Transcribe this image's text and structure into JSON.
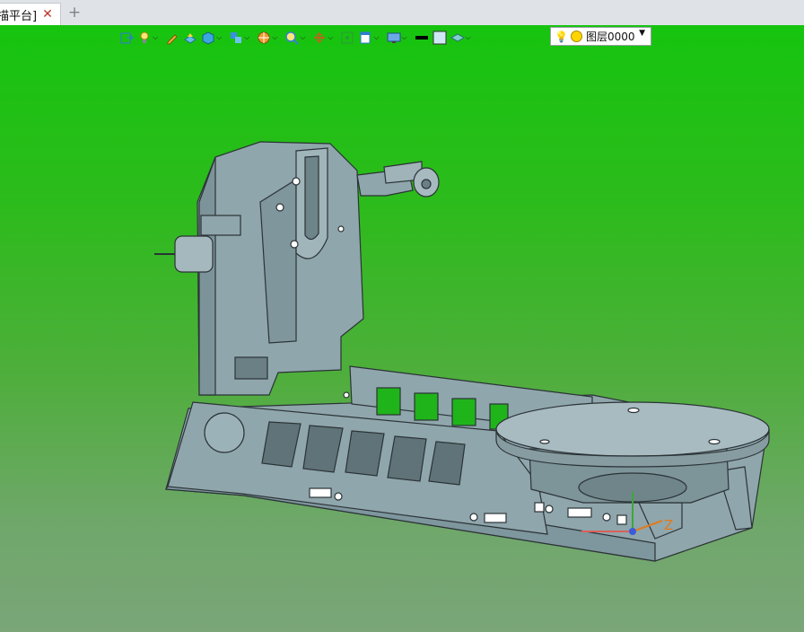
{
  "tabs": [
    {
      "label": "描平台]",
      "close_icon": "close-icon"
    }
  ],
  "add_tab_glyph": "+",
  "toolbar": {
    "icons": [
      "exit-sketch-icon",
      "light-bulb-icon",
      "pencil-icon",
      "extrude-icon",
      "solid-cube-icon",
      "assembly-cube-icon",
      "render-sphere-icon",
      "zoom-icon",
      "rotate-axis-icon",
      "fit-view-icon",
      "view-panel-icon",
      "display-monitor-icon",
      "line-color-swatch-icon",
      "fill-color-swatch-icon",
      "layer-stack-icon"
    ]
  },
  "layer_select": {
    "value": "图层0000",
    "dropdown_glyph": "▼"
  },
  "axis_label": "Z",
  "colors": {
    "viewport_top": "#16c40f",
    "viewport_bottom": "#7aa678",
    "model_fill": "#8fa6ac",
    "model_stroke": "#2b3336",
    "axis_z": "#e07b1f"
  }
}
